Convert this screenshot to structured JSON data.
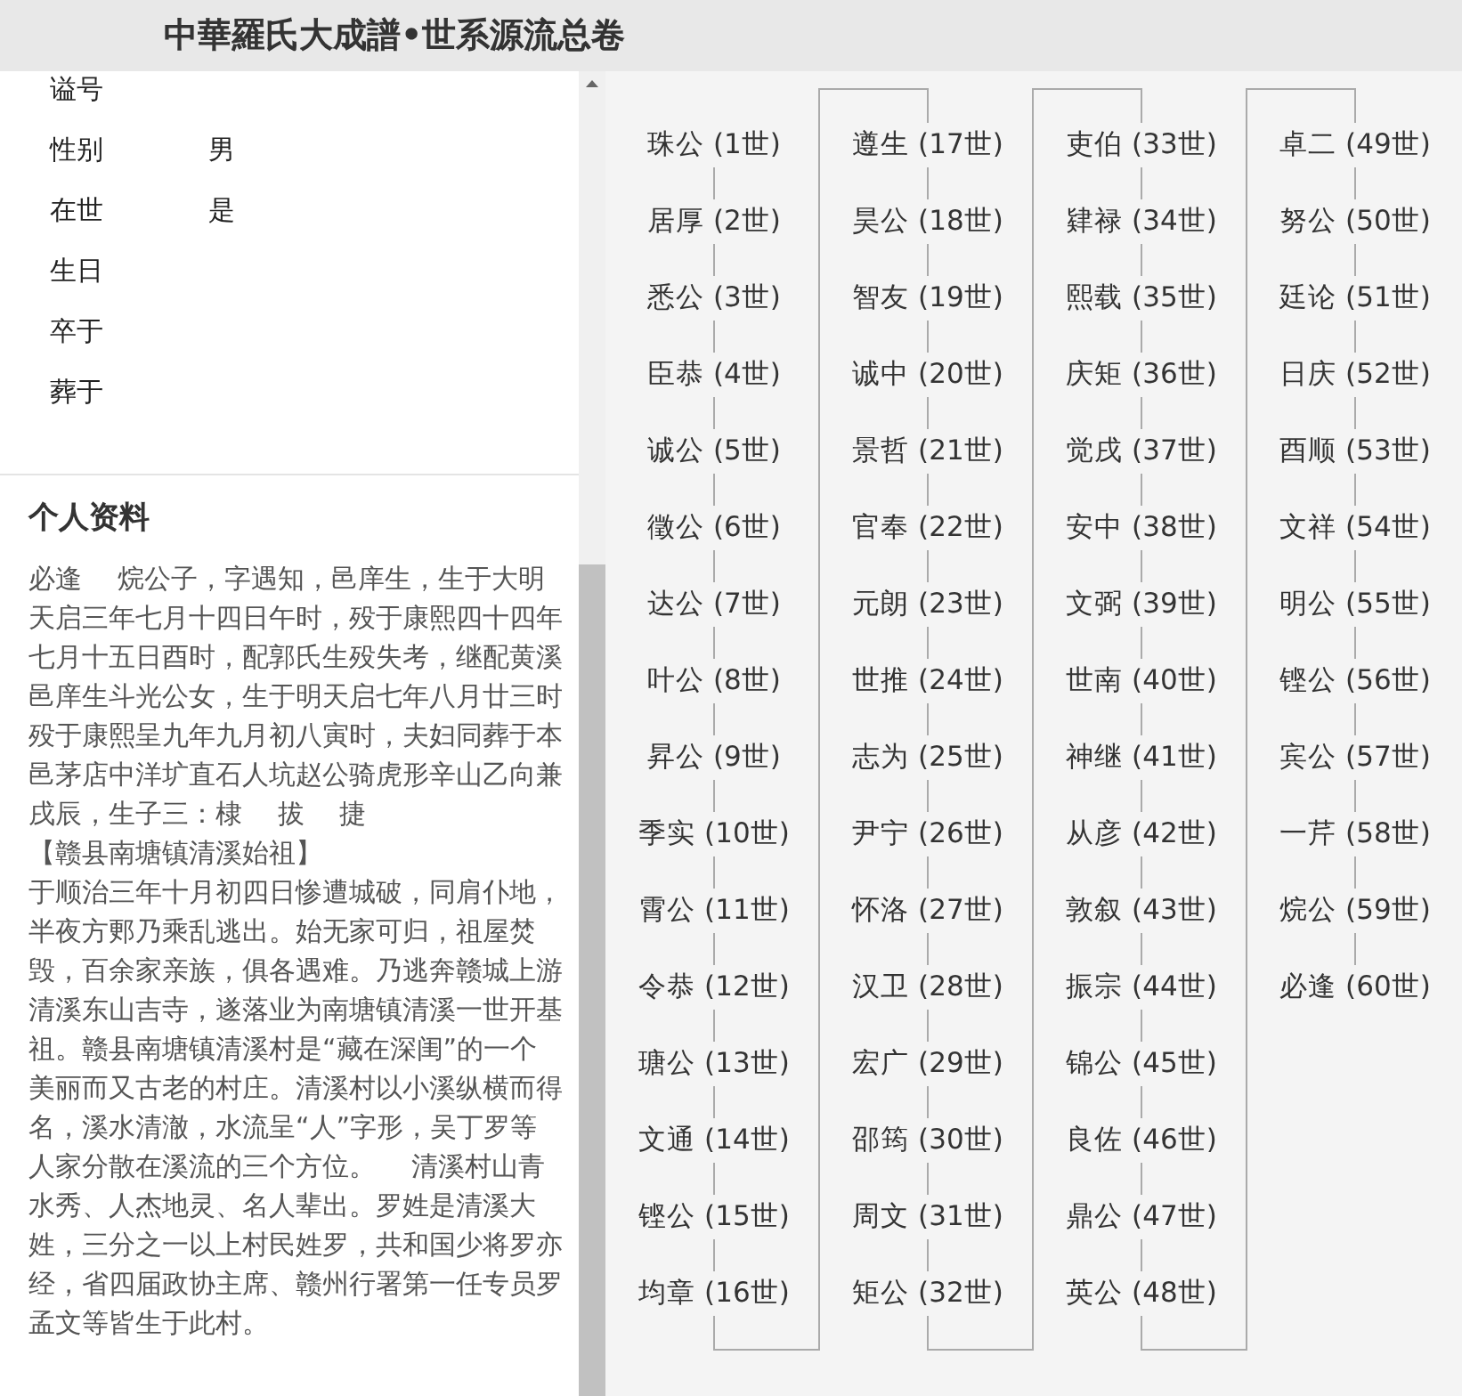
{
  "header": {
    "title": "中華羅氏大成譜•世系源流总卷"
  },
  "fields": [
    {
      "label": "谥号"
    },
    {
      "label": "性别",
      "value": "男"
    },
    {
      "label": "在世",
      "value": "是"
    },
    {
      "label": "生日"
    },
    {
      "label": "卒于"
    },
    {
      "label": "葬于"
    }
  ],
  "profile": {
    "heading": "个人资料",
    "paragraphs": [
      "必逢　 烷公子，字遇知，邑庠生，生于大明天启三年七月十四日午时，殁于康熙四十四年七月十五日酉时，配郭氏生殁失考，继配黄溪邑庠生斗光公女，生于明天启七年八月廿三时殁于康熙呈九年九月初八寅时，夫妇同葬于本邑茅店中洋圹直石人坑赵公骑虎形辛山乙向兼戌辰，生子三：棣　 拔　 捷",
      "【赣县南塘镇清溪始祖】",
      "于顺治三年十月初四日惨遭城破，同肩仆地，半夜方郠乃乘乱逃出。始无家可归，祖屋焚毁，百余家亲族，俱各遇难。乃逃奔赣城上游清溪东山吉寺，遂落业为南塘镇清溪一世开基祖。赣县南塘镇清溪村是“藏在深闺”的一个美丽而又古老的村庄。清溪村以小溪纵横而得名，溪水清澈，水流呈“人”字形，吴丁罗等人家分散在溪流的三个方位。　 清溪村山青水秀、人杰地灵、名人辈出。罗姓是清溪大姓，三分之一以上村民姓罗，共和国少将罗亦经，省四届政协主席、赣州行署第一任专员罗孟文等皆生于此村。"
    ]
  },
  "lineage": [
    [
      "珠公 (1世)",
      "居厚 (2世)",
      "悉公 (3世)",
      "臣恭 (4世)",
      "诚公 (5世)",
      "徵公 (6世)",
      "达公 (7世)",
      "叶公 (8世)",
      "昇公 (9世)",
      "季实 (10世)",
      "霄公 (11世)",
      "令恭 (12世)",
      "瑭公 (13世)",
      "文通 (14世)",
      "铿公 (15世)",
      "均章 (16世)"
    ],
    [
      "遵生 (17世)",
      "昊公 (18世)",
      "智友 (19世)",
      "诚中 (20世)",
      "景哲 (21世)",
      "官奉 (22世)",
      "元朗 (23世)",
      "世推 (24世)",
      "志为 (25世)",
      "尹宁 (26世)",
      "怀洛 (27世)",
      "汉卫 (28世)",
      "宏广 (29世)",
      "邵筠 (30世)",
      "周文 (31世)",
      "矩公 (32世)"
    ],
    [
      "吏伯 (33世)",
      "肄禄 (34世)",
      "熙载 (35世)",
      "庆矩 (36世)",
      "觉戌 (37世)",
      "安中 (38世)",
      "文弼 (39世)",
      "世南 (40世)",
      "神继 (41世)",
      "从彦 (42世)",
      "敦叙 (43世)",
      "振宗 (44世)",
      "锦公 (45世)",
      "良佐 (46世)",
      "鼎公 (47世)",
      "英公 (48世)"
    ],
    [
      "卓二 (49世)",
      "努公 (50世)",
      "廷论 (51世)",
      "日庆 (52世)",
      "酉顺 (53世)",
      "文祥 (54世)",
      "明公 (55世)",
      "铿公 (56世)",
      "宾公 (57世)",
      "一芹 (58世)",
      "烷公 (59世)",
      "必逢 (60世)"
    ]
  ]
}
